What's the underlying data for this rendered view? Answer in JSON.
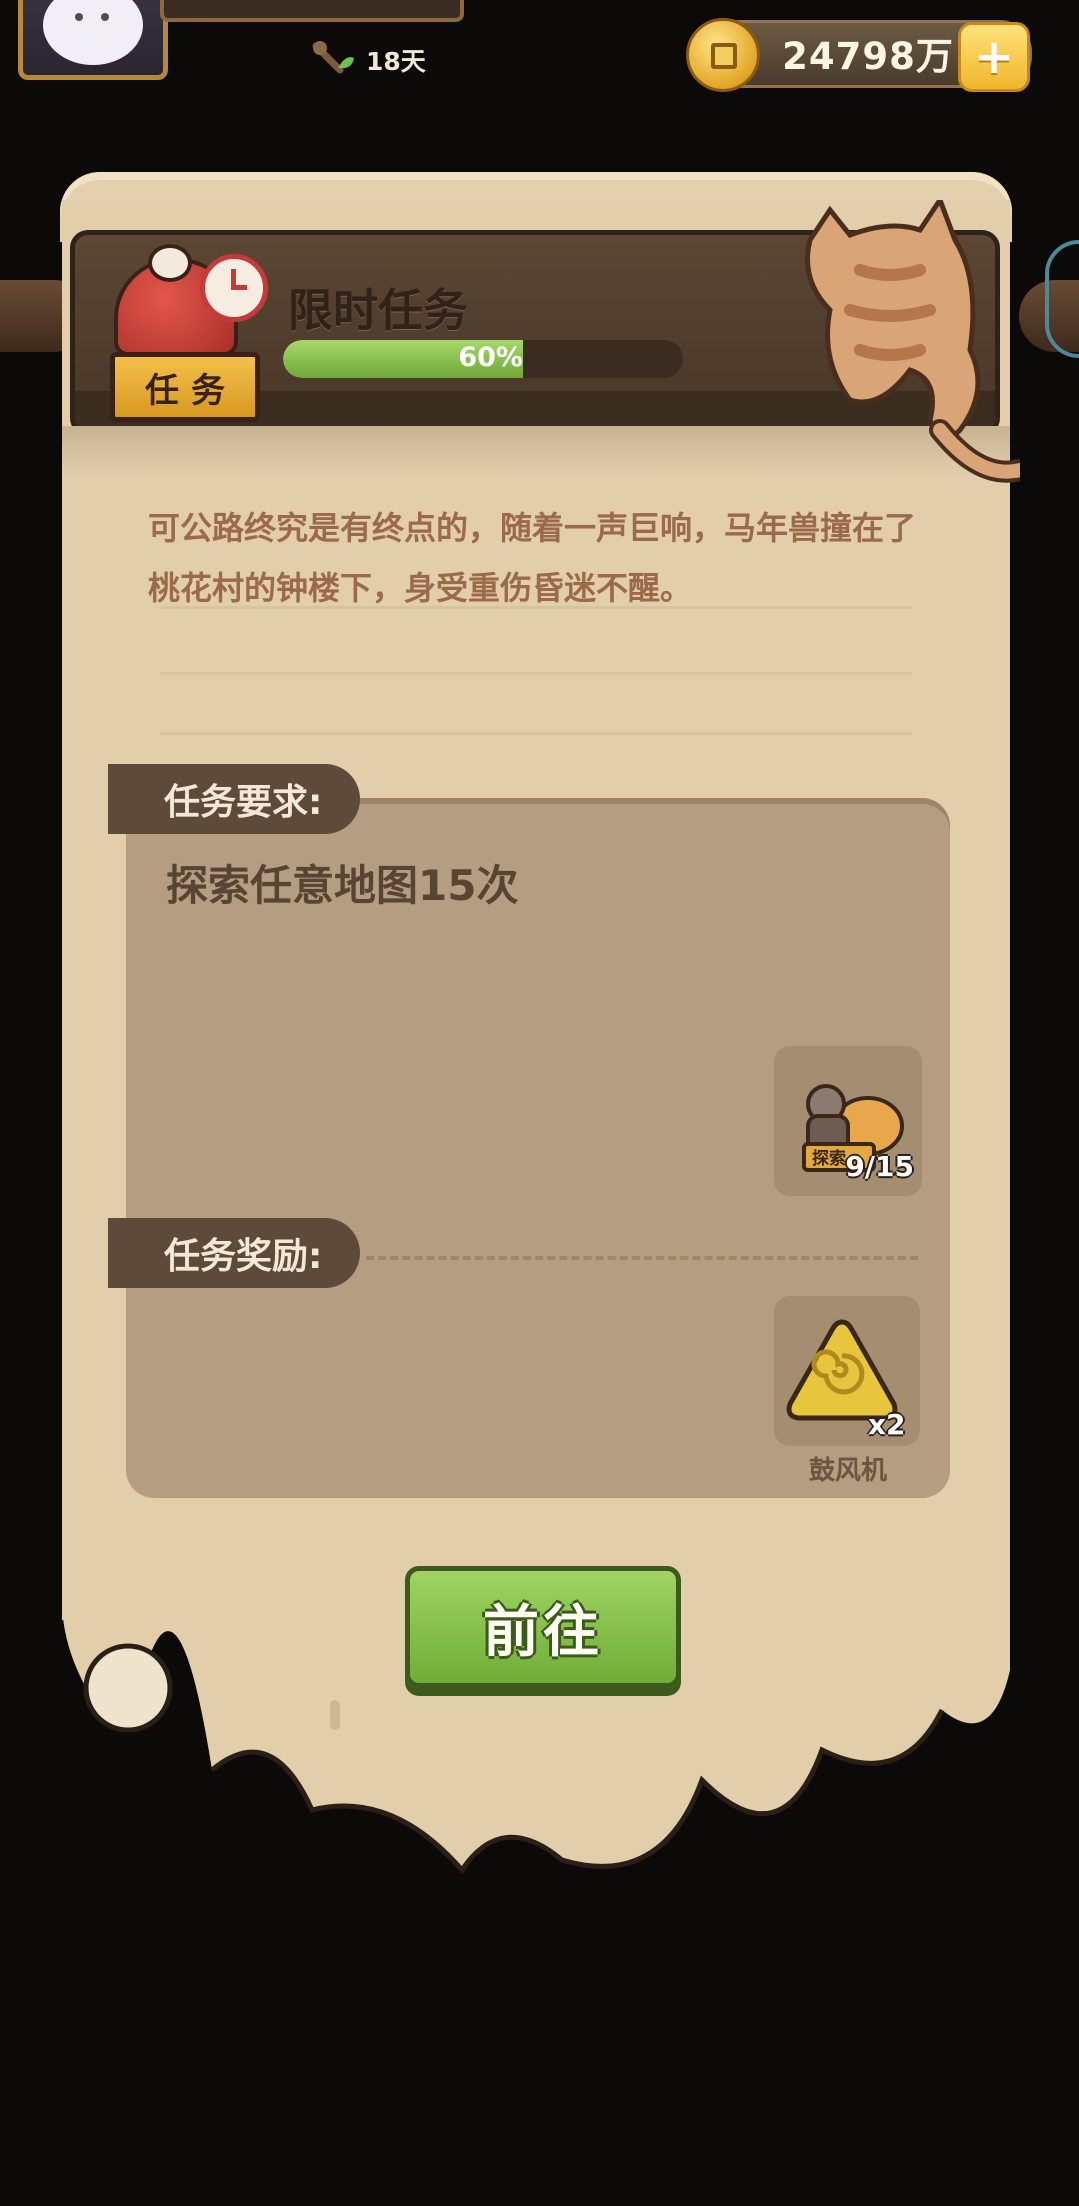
{
  "hud": {
    "days": "18天",
    "coins": "24798万",
    "add_symbol": "+"
  },
  "task": {
    "badge": "任务",
    "title": "限时任务",
    "progress_percent": 60,
    "progress_label": "60%",
    "story": "可公路终究是有终点的，随着一声巨响，马年兽撞在了桃花村的钟楼下，身受重伤昏迷不醒。",
    "requirement_heading": "任务要求:",
    "requirement": "探索任意地图15次",
    "explore_badge": "探索",
    "explore_progress": "9/15",
    "reward_heading": "任务奖励:",
    "reward_item": {
      "name": "鼓风机",
      "quantity": "x2"
    },
    "go_button": "前往"
  },
  "colors": {
    "parchment": "#e2ceab",
    "panel": "#b49d80",
    "progress_fill": "#8cc652",
    "button_green": "#86c24a"
  }
}
